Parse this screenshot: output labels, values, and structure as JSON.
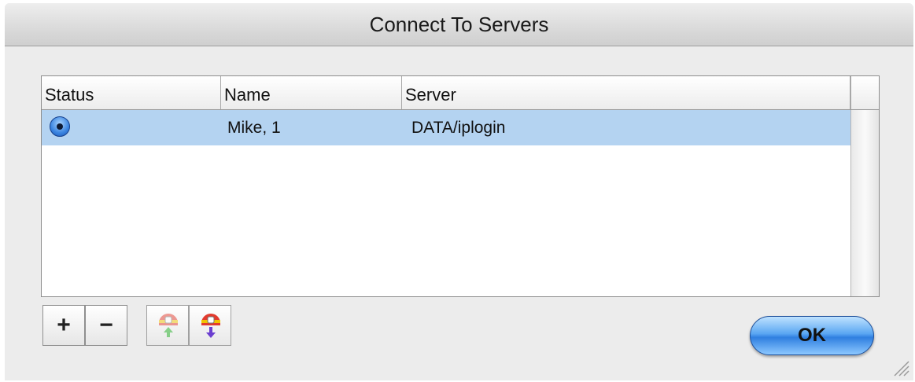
{
  "window": {
    "title": "Connect To Servers"
  },
  "table": {
    "columns": [
      "Status",
      "Name",
      "Server"
    ],
    "rows": [
      {
        "status": "connected",
        "name": "Mike, 1",
        "server": "DATA/iplogin"
      }
    ]
  },
  "toolbar": {
    "add_label": "+",
    "remove_label": "−",
    "move_up_icon": "move-up-icon",
    "move_down_icon": "move-down-icon"
  },
  "actions": {
    "ok_label": "OK"
  },
  "colors": {
    "selection": "#b4d3f1",
    "ok_button": "#3a88e6"
  }
}
